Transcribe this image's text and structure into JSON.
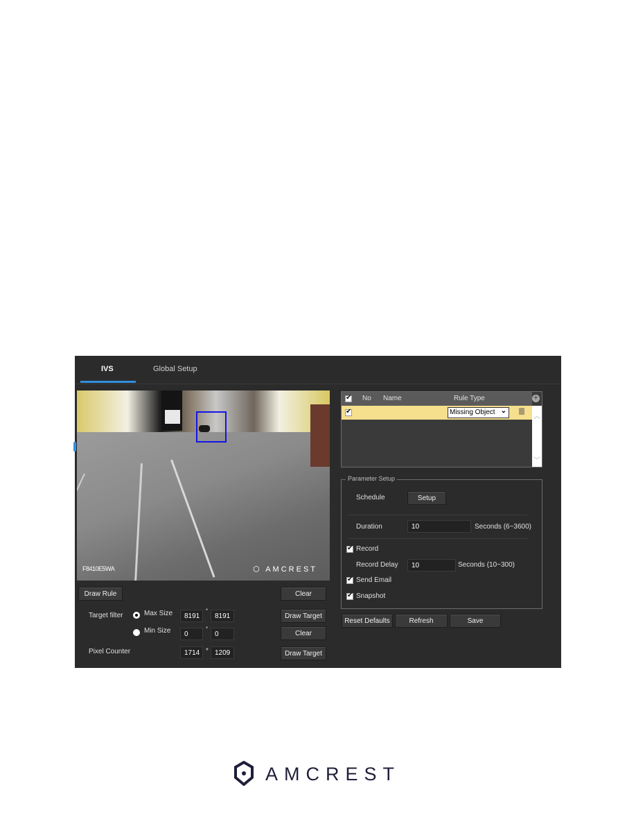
{
  "tabs": [
    {
      "label": "IVS",
      "active": true
    },
    {
      "label": "Global Setup",
      "active": false
    }
  ],
  "video": {
    "osd_name": "F8410E5WA",
    "osd_logo": "AMCREST"
  },
  "video_controls": {
    "draw_rule": "Draw Rule",
    "clear_top": "Clear",
    "target_filter_label": "Target filter",
    "max_size_label": "Max Size",
    "max_size_w": "8191",
    "max_size_h": "8191",
    "min_size_label": "Min Size",
    "min_size_w": "0",
    "min_size_h": "0",
    "draw_target_1": "Draw Target",
    "clear_2": "Clear",
    "pixel_counter_label": "Pixel Counter",
    "pixel_w": "1714",
    "pixel_h": "1209",
    "draw_target_2": "Draw Target",
    "separator": "*",
    "selected_size": "Max Size"
  },
  "rules_table": {
    "headers": {
      "no": "No",
      "name": "Name",
      "rule_type": "Rule Type"
    },
    "rows": [
      {
        "checked": true,
        "no": "",
        "name": "",
        "rule_type": "Missing Object"
      }
    ],
    "select_chevron": "⌄"
  },
  "parameter_setup": {
    "title": "Parameter Setup",
    "schedule_label": "Schedule",
    "setup_button": "Setup",
    "duration_label": "Duration",
    "duration_value": "10",
    "duration_hint": "Seconds (6~3600)",
    "record_label": "Record",
    "record_checked": true,
    "record_delay_label": "Record Delay",
    "record_delay_value": "10",
    "record_delay_hint": "Seconds (10~300)",
    "send_email_label": "Send Email",
    "send_email_checked": true,
    "snapshot_label": "Snapshot",
    "snapshot_checked": true
  },
  "footer_buttons": {
    "reset": "Reset Defaults",
    "refresh": "Refresh",
    "save": "Save"
  },
  "brand": {
    "logo_text": "AMCREST",
    "accent": "#2f8fe0",
    "highlight_row": "#f6df8d",
    "rule_box": "#1414e6"
  }
}
